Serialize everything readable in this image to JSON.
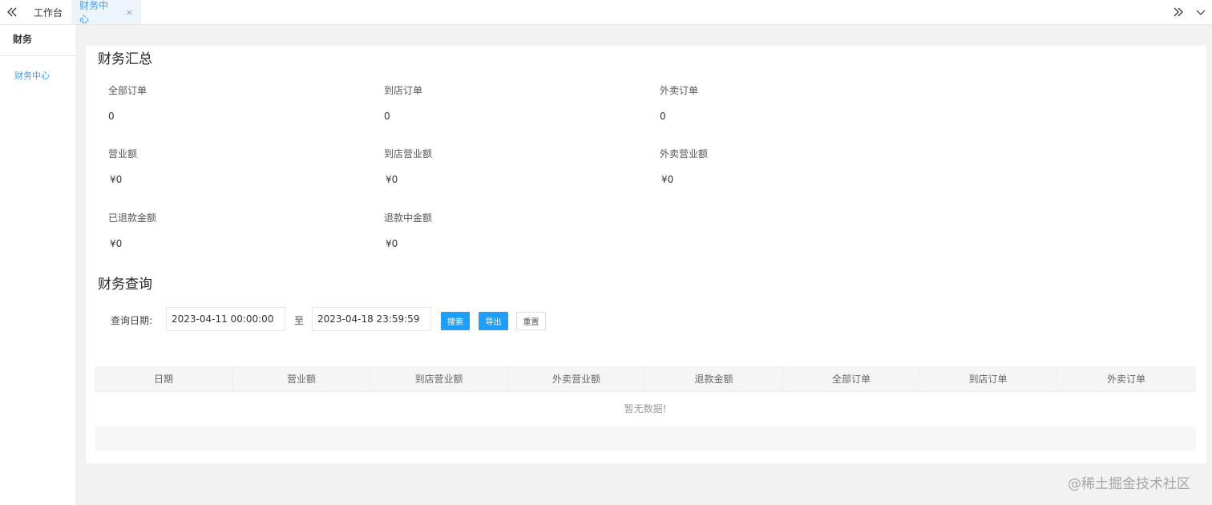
{
  "topbar": {
    "tabs": [
      {
        "label": "工作台"
      },
      {
        "label": "财务中心",
        "close": "×"
      }
    ]
  },
  "sidebar": {
    "title": "财务",
    "items": [
      {
        "label": "财务中心"
      }
    ]
  },
  "summary": {
    "title": "财务汇总",
    "stats": [
      {
        "label": "全部订单",
        "value": "0"
      },
      {
        "label": "到店订单",
        "value": "0"
      },
      {
        "label": "外卖订单",
        "value": "0"
      },
      {
        "label": "营业额",
        "value": "¥0"
      },
      {
        "label": "到店营业额",
        "value": "¥0"
      },
      {
        "label": "外卖营业额",
        "value": "¥0"
      },
      {
        "label": "已退款金额",
        "value": "¥0"
      },
      {
        "label": "退款中金额",
        "value": "¥0"
      }
    ]
  },
  "query": {
    "title": "财务查询",
    "date_label": "查询日期:",
    "start": "2023-04-11 00:00:00",
    "separator": "至",
    "end": "2023-04-18 23:59:59",
    "search": "搜索",
    "export": "导出",
    "reset": "重置"
  },
  "table": {
    "columns": [
      "日期",
      "营业额",
      "到店营业额",
      "外卖营业额",
      "退款金额",
      "全部订单",
      "到店订单",
      "外卖订单"
    ],
    "empty": "暂无数据!"
  },
  "watermark": "@稀土掘金技术社区",
  "colors": {
    "accent": "#1e9fff",
    "link": "#409eff"
  }
}
